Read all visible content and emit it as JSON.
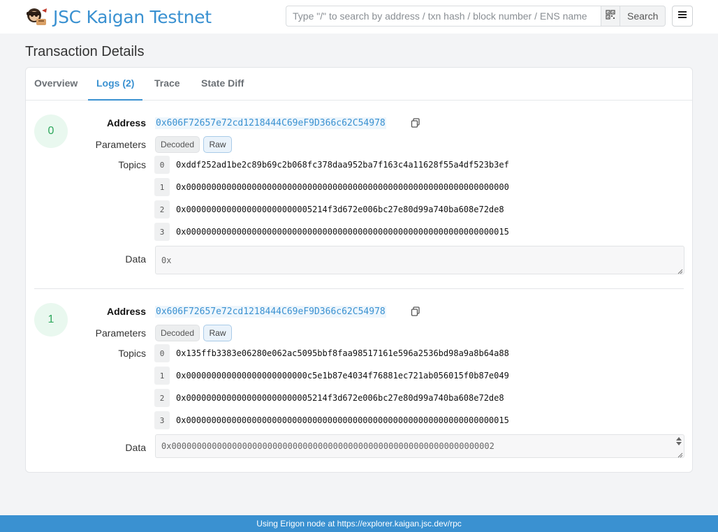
{
  "header": {
    "brand_title": "JSC Kaigan Testnet",
    "search_placeholder": "Type \"/\" to search by address / txn hash / block number / ENS name",
    "search_label": "Search",
    "brand_icon": "kaigan-logo-icon",
    "qr_icon": "qr-code-icon",
    "menu_icon": "hamburger-menu-icon"
  },
  "page": {
    "title": "Transaction Details"
  },
  "tabs": [
    {
      "label": "Overview",
      "active": false
    },
    {
      "label": "Logs (2)",
      "active": true
    },
    {
      "label": "Trace",
      "active": false
    },
    {
      "label": "State Diff",
      "active": false
    }
  ],
  "logs": [
    {
      "index": "0",
      "address_label": "Address",
      "address": "0x606F72657e72cd1218444C69eF9D366c62C54978",
      "parameters_label": "Parameters",
      "decoded_label": "Decoded",
      "raw_label": "Raw",
      "topics_label": "Topics",
      "topics": [
        {
          "idx": "0",
          "value": "0xddf252ad1be2c89b69c2b068fc378daa952ba7f163c4a11628f55a4df523b3ef"
        },
        {
          "idx": "1",
          "value": "0x0000000000000000000000000000000000000000000000000000000000000000"
        },
        {
          "idx": "2",
          "value": "0x0000000000000000000000005214f3d672e006bc27e80d99a740ba608e72de8"
        },
        {
          "idx": "3",
          "value": "0x0000000000000000000000000000000000000000000000000000000000000015"
        }
      ],
      "data_label": "Data",
      "data": "0x"
    },
    {
      "index": "1",
      "address_label": "Address",
      "address": "0x606F72657e72cd1218444C69eF9D366c62C54978",
      "parameters_label": "Parameters",
      "decoded_label": "Decoded",
      "raw_label": "Raw",
      "topics_label": "Topics",
      "topics": [
        {
          "idx": "0",
          "value": "0x135ffb3383e06280e062ac5095bbf8faa98517161e596a2536bd98a9a8b64a88"
        },
        {
          "idx": "1",
          "value": "0x000000000000000000000000c5e1b87e4034f76881ec721ab056015f0b87e049"
        },
        {
          "idx": "2",
          "value": "0x0000000000000000000000005214f3d672e006bc27e80d99a740ba608e72de8"
        },
        {
          "idx": "3",
          "value": "0x0000000000000000000000000000000000000000000000000000000000000015"
        }
      ],
      "data_label": "Data",
      "data": "0x0000000000000000000000000000000000000000000000000000000000000002"
    }
  ],
  "footer": {
    "text": "Using Erigon node at https://explorer.kaigan.jsc.dev/rpc"
  },
  "colors": {
    "accent": "#3a91d1",
    "index_badge_bg": "#e9f8ef",
    "index_badge_text": "#2fa85d"
  }
}
